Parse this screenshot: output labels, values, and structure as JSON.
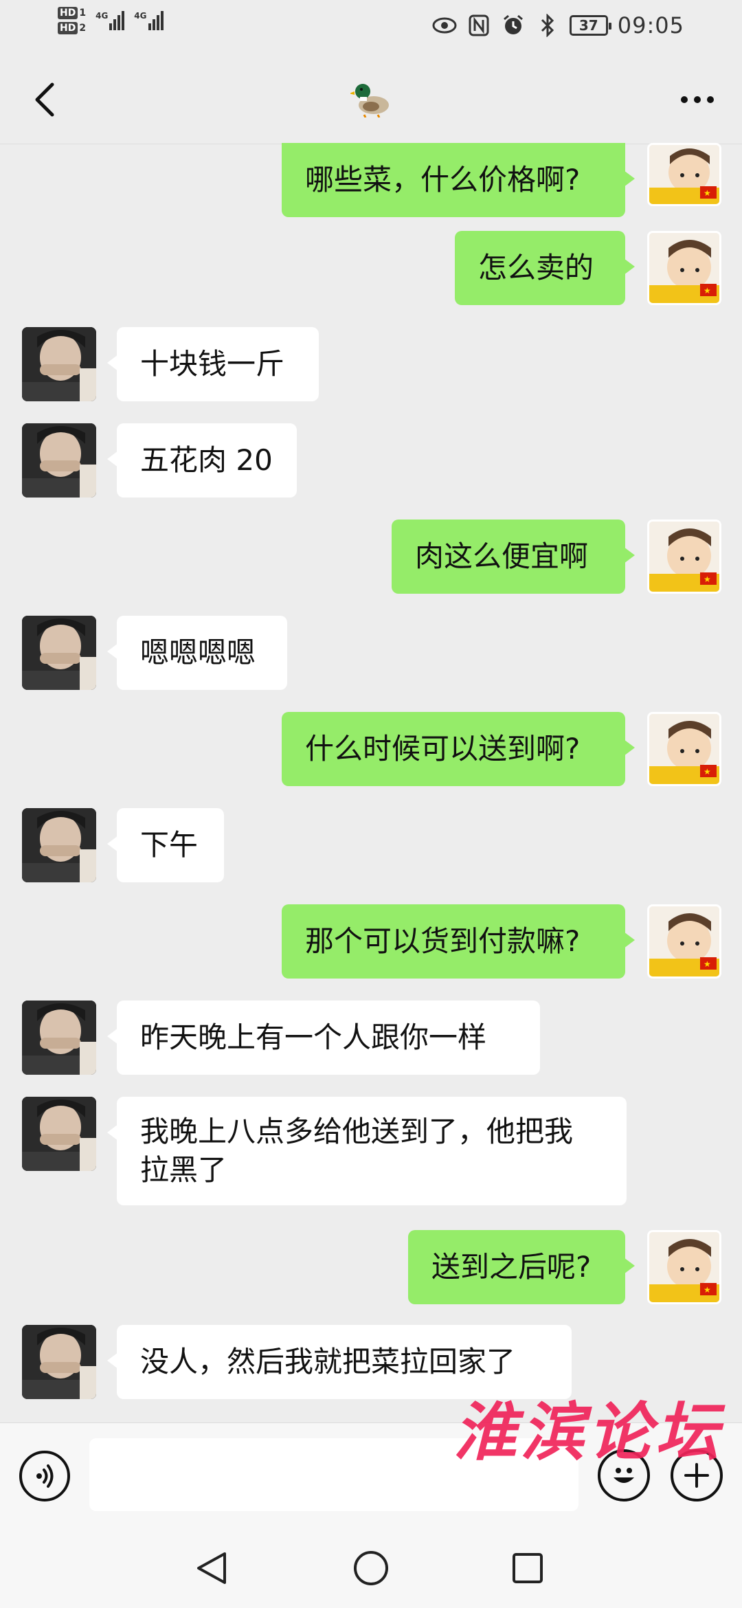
{
  "status_bar": {
    "hd1": "HD",
    "hd1_num": "1",
    "hd2": "HD",
    "hd2_num": "2",
    "net1": "4G",
    "net2": "4G",
    "battery": "37",
    "time": "09:05"
  },
  "nav": {
    "title_icon": "duck-icon",
    "back_icon": "back-chevron-icon",
    "more_icon": "more-dots-icon"
  },
  "messages": [
    {
      "from": "me",
      "text": "哪些菜，什么价格啊?"
    },
    {
      "from": "me",
      "text": "怎么卖的"
    },
    {
      "from": "them",
      "text": "十块钱一斤"
    },
    {
      "from": "them",
      "text": "五花肉 20"
    },
    {
      "from": "me",
      "text": "肉这么便宜啊"
    },
    {
      "from": "them",
      "text": "嗯嗯嗯嗯"
    },
    {
      "from": "me",
      "text": "什么时候可以送到啊?"
    },
    {
      "from": "them",
      "text": "下午"
    },
    {
      "from": "me",
      "text": "那个可以货到付款嘛?"
    },
    {
      "from": "them",
      "text": "昨天晚上有一个人跟你一样"
    },
    {
      "from": "them",
      "line1": "我晚上八点多给他送到了，他把我",
      "line2": "拉黑了"
    },
    {
      "from": "me",
      "text": "送到之后呢?"
    },
    {
      "from": "them",
      "text": "没人，然后我就把菜拉回家了"
    }
  ],
  "input": {
    "value": "",
    "voice_icon": "voice-icon",
    "emoji_icon": "emoji-icon",
    "plus_icon": "plus-icon"
  },
  "watermark": "淮滨论坛",
  "system_nav": {
    "back": "back-triangle-icon",
    "home": "home-circle-icon",
    "recents": "recents-square-icon"
  },
  "colors": {
    "my_bubble": "#95ec69",
    "their_bubble": "#ffffff",
    "background": "#ededed",
    "watermark": "#f0245a"
  }
}
